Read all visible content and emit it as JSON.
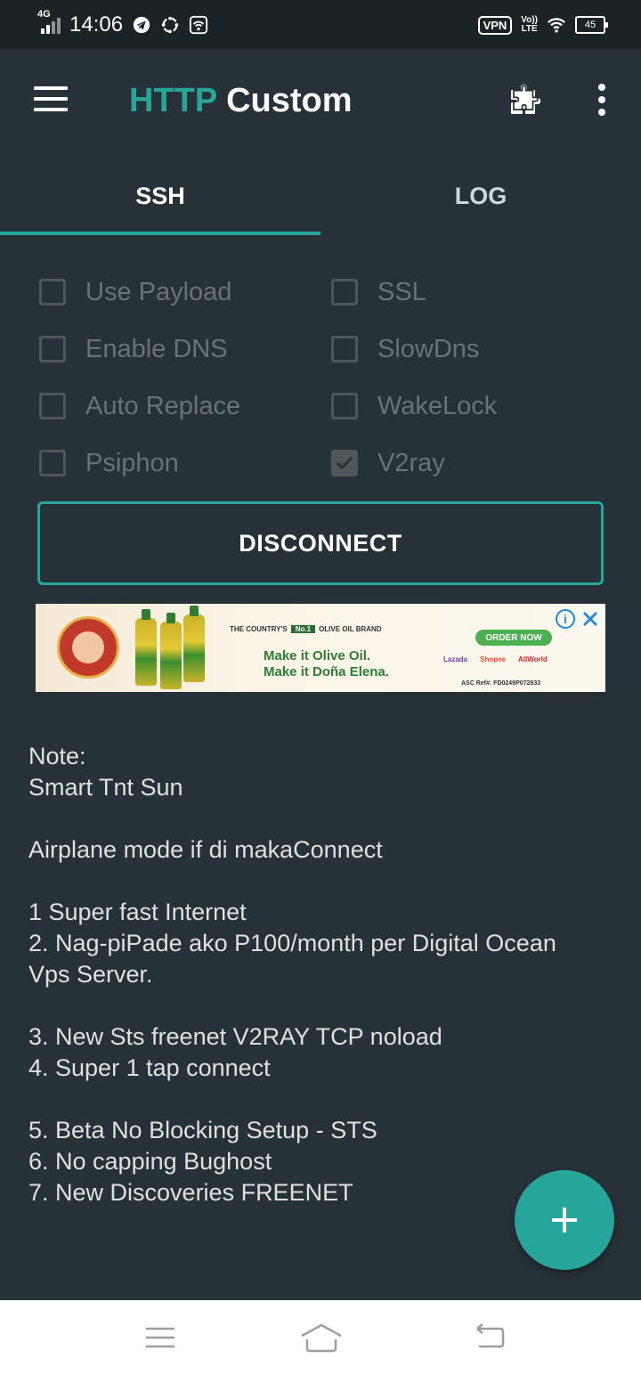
{
  "status_bar": {
    "network": "4G",
    "time": "14:06",
    "vpn": "VPN",
    "volte_top": "Vo))",
    "volte_bottom": "LTE",
    "battery": "45"
  },
  "app_bar": {
    "title_part1": "HTTP",
    "title_part2": "Custom",
    "icons": [
      "menu-icon",
      "puzzle-icon",
      "more-vert-icon"
    ]
  },
  "tabs": [
    {
      "label": "SSH",
      "active": true
    },
    {
      "label": "LOG",
      "active": false
    }
  ],
  "options": {
    "use_payload": {
      "label": "Use Payload",
      "checked": false
    },
    "ssl": {
      "label": "SSL",
      "checked": false
    },
    "enable_dns": {
      "label": "Enable DNS",
      "checked": false
    },
    "slowdns": {
      "label": "SlowDns",
      "checked": false
    },
    "auto_replace": {
      "label": "Auto Replace",
      "checked": false
    },
    "wakelock": {
      "label": "WakeLock",
      "checked": false
    },
    "psiphon": {
      "label": "Psiphon",
      "checked": false
    },
    "v2ray": {
      "label": "V2ray",
      "checked": true
    }
  },
  "disconnect_button": "DISCONNECT",
  "ad": {
    "tagline_prefix": "THE COUNTRY'S",
    "badge": "No.1",
    "tagline_suffix": "OLIVE OIL BRAND",
    "line1": "Make it Olive Oil.",
    "line2": "Make it Doña Elena.",
    "order_button": "ORDER NOW",
    "shops": [
      "Lazada",
      "Shopee",
      "AllWorld"
    ],
    "asc_ref": "ASC Ref#: FD0249P072833",
    "info_glyph": "i"
  },
  "note": {
    "lines": [
      "Note:",
      "Smart Tnt Sun",
      "",
      "Airplane mode if di makaConnect",
      "",
      "1 Super fast Internet",
      "2. Nag-piPade ako P100/month per Digital Ocean",
      "Vps Server.",
      "",
      "3. New Sts freenet V2RAY TCP noload",
      "4. Super 1 tap connect",
      "",
      "5. Beta No Blocking Setup - STS",
      "6. No capping Bughost",
      "7. New Discoveries FREENET"
    ]
  },
  "colors": {
    "accent": "#26a69a",
    "background": "#263238",
    "statusbar": "#1b2327",
    "disabled_text": "#6b7275"
  }
}
